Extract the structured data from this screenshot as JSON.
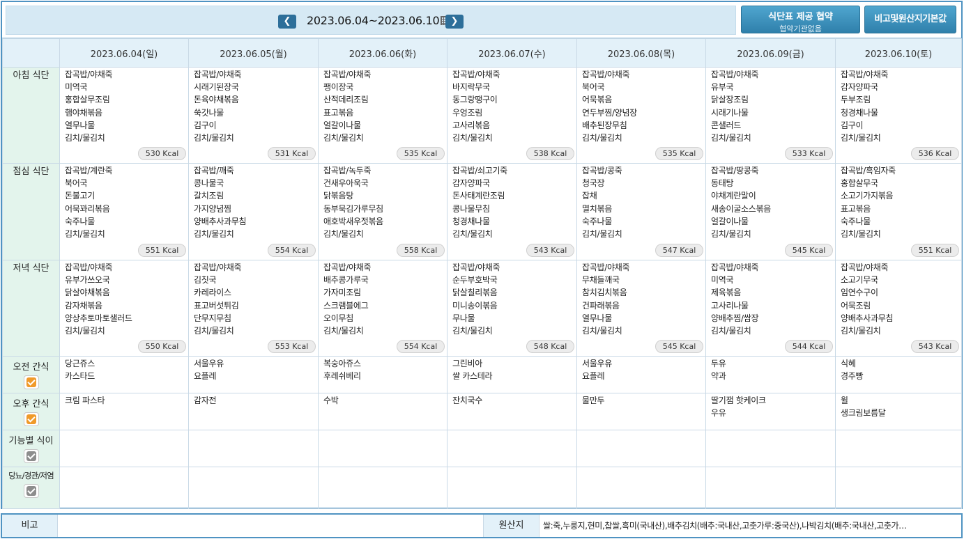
{
  "header": {
    "date_range": "2023.06.04~2023.06.10",
    "agree_button": "식단표 제공 협약",
    "agree_sub": "협약기관없음",
    "origin_button": "비고및원산지기본값"
  },
  "days": [
    {
      "date": "2023.06.04(일)",
      "type": "sun"
    },
    {
      "date": "2023.06.05(월)",
      "type": "weekday"
    },
    {
      "date": "2023.06.06(화)",
      "type": "holiday"
    },
    {
      "date": "2023.06.07(수)",
      "type": "weekday"
    },
    {
      "date": "2023.06.08(목)",
      "type": "weekday"
    },
    {
      "date": "2023.06.09(금)",
      "type": "weekday"
    },
    {
      "date": "2023.06.10(토)",
      "type": "sat"
    }
  ],
  "rows": {
    "breakfast": "아침 식단",
    "lunch": "점심 식단",
    "dinner": "저녁 식단",
    "am_snack": "오전 간식",
    "pm_snack": "오후 간식",
    "functional": "기능별 식이",
    "diabetes": "당뇨/경관/저염"
  },
  "meals": {
    "breakfast": [
      {
        "items": [
          "잡곡밥/야채죽",
          "미역국",
          "홍합살무조림",
          "햄야채볶음",
          "열무나물",
          "김치/물김치"
        ],
        "kcal": "530 Kcal"
      },
      {
        "items": [
          "잡곡밥/야채죽",
          "시래기된장국",
          "돈육야채볶음",
          "쑥갓나물",
          "김구이",
          "김치/물김치"
        ],
        "kcal": "531 Kcal"
      },
      {
        "items": [
          "잡곡밥/야채죽",
          "팽이장국",
          "산적데리조림",
          "표고볶음",
          "얼갈이나물",
          "김치/물김치"
        ],
        "kcal": "535 Kcal"
      },
      {
        "items": [
          "잡곡밥/야채죽",
          "바지락무국",
          "동그랑땡구이",
          "우엉조림",
          "고사리볶음",
          "김치/물김치"
        ],
        "kcal": "538 Kcal"
      },
      {
        "items": [
          "잡곡밥/야채죽",
          "북어국",
          "어묵볶음",
          "연두부찜/양념장",
          "배추된장무침",
          "김치/물김치"
        ],
        "kcal": "535 Kcal"
      },
      {
        "items": [
          "잡곡밥/야채죽",
          "유부국",
          "닭살장조림",
          "시래기나물",
          "콘샐러드",
          "김치/물김치"
        ],
        "kcal": "533 Kcal"
      },
      {
        "items": [
          "잡곡밥/야채죽",
          "감자양파국",
          "두부조림",
          "청경채나물",
          "김구이",
          "김치/물김치"
        ],
        "kcal": "536 Kcal"
      }
    ],
    "lunch": [
      {
        "items": [
          "잡곡밥/계란죽",
          "북어국",
          "돈불고기",
          "어묵꽈리볶음",
          "숙주나물",
          "김치/물김치"
        ],
        "kcal": "551 Kcal"
      },
      {
        "items": [
          "잡곡밥/깨죽",
          "콩나물국",
          "갈치조림",
          "가지양념찜",
          "양배추사과무침",
          "김치/물김치"
        ],
        "kcal": "554 Kcal"
      },
      {
        "items": [
          "잡곡밥/녹두죽",
          "건새우아욱국",
          "닭볶음탕",
          "동부묵김가루무침",
          "애호박새우젓볶음",
          "김치/물김치"
        ],
        "kcal": "558 Kcal"
      },
      {
        "items": [
          "잡곡밥/쇠고기죽",
          "감자양파국",
          "돈사태계란조림",
          "콩나물무침",
          "청경채나물",
          "김치/물김치"
        ],
        "kcal": "543 Kcal"
      },
      {
        "items": [
          "잡곡밥/콩죽",
          "청국장",
          "잡채",
          "멸치볶음",
          "숙주나물",
          "김치/물김치"
        ],
        "kcal": "547 Kcal"
      },
      {
        "items": [
          "잡곡밥/땅콩죽",
          "동태탕",
          "야채계란말이",
          "새송이굴소스볶음",
          "얼갈이나물",
          "김치/물김치"
        ],
        "kcal": "545 Kcal"
      },
      {
        "items": [
          "잡곡밥/흑임자죽",
          "홍합살무국",
          "소고기가지볶음",
          "표고볶음",
          "숙주나물",
          "김치/물김치"
        ],
        "kcal": "551 Kcal"
      }
    ],
    "dinner": [
      {
        "items": [
          "잡곡밥/야채죽",
          "유부가쓰오국",
          "닭살야채볶음",
          "감자채볶음",
          "양상추토마토샐러드",
          "김치/물김치"
        ],
        "kcal": "550 Kcal"
      },
      {
        "items": [
          "잡곡밥/야채죽",
          "김칫국",
          "카레라이스",
          "표고버섯튀김",
          "단무지무침",
          "김치/물김치"
        ],
        "kcal": "553 Kcal"
      },
      {
        "items": [
          "잡곡밥/야채죽",
          "배추콩가루국",
          "가자미조림",
          "스크램블에그",
          "오이무침",
          "김치/물김치"
        ],
        "kcal": "554 Kcal"
      },
      {
        "items": [
          "잡곡밥/야채죽",
          "순두부호박국",
          "닭살칠리볶음",
          "미니송이볶음",
          "무나물",
          "김치/물김치"
        ],
        "kcal": "548 Kcal"
      },
      {
        "items": [
          "잡곡밥/야채죽",
          "무채들깨국",
          "참치김치볶음",
          "건파래볶음",
          "열무나물",
          "김치/물김치"
        ],
        "kcal": "545 Kcal"
      },
      {
        "items": [
          "잡곡밥/야채죽",
          "미역국",
          "제육볶음",
          "고사리나물",
          "양배추찜/쌈장",
          "김치/물김치"
        ],
        "kcal": "544 Kcal"
      },
      {
        "items": [
          "잡곡밥/야채죽",
          "소고기무국",
          "임연수구이",
          "어묵조림",
          "양배추사과무침",
          "김치/물김치"
        ],
        "kcal": "543 Kcal"
      }
    ],
    "am_snack": [
      [
        "당근쥬스",
        "카스타드"
      ],
      [
        "서울우유",
        "요플레"
      ],
      [
        "복숭아쥬스",
        "후레쉬베리"
      ],
      [
        "그린비아",
        "쌀 카스테라"
      ],
      [
        "서울우유",
        "요플레"
      ],
      [
        "두유",
        "약과"
      ],
      [
        "식혜",
        "경주빵"
      ]
    ],
    "pm_snack": [
      [
        "크림 파스타"
      ],
      [
        "감자전"
      ],
      [
        "수박"
      ],
      [
        "잔치국수"
      ],
      [
        "물만두"
      ],
      [
        "딸기잼 핫케이크",
        "우유"
      ],
      [
        "윌",
        "생크림보름달"
      ]
    ]
  },
  "checkboxes": {
    "am_snack": "checked",
    "pm_snack": "checked",
    "functional": "unchecked",
    "diabetes": "unchecked"
  },
  "remark": {
    "label": "비고",
    "value": "",
    "origin_label": "원산지",
    "origin_text": "쌀:죽,누룽지,현미,찹쌀,흑미(국내산),배추김치(배추:국내산,고춧가루:중국산),나박김치(배추:국내산,고춧가…"
  },
  "colors": {
    "sunday": "#d4334b",
    "saturday": "#2546b8",
    "border": "#4f93c2",
    "header_bg": "#e3f1f9",
    "rowhead_bg": "#e3f4ec",
    "checked": "#f09a2a"
  }
}
